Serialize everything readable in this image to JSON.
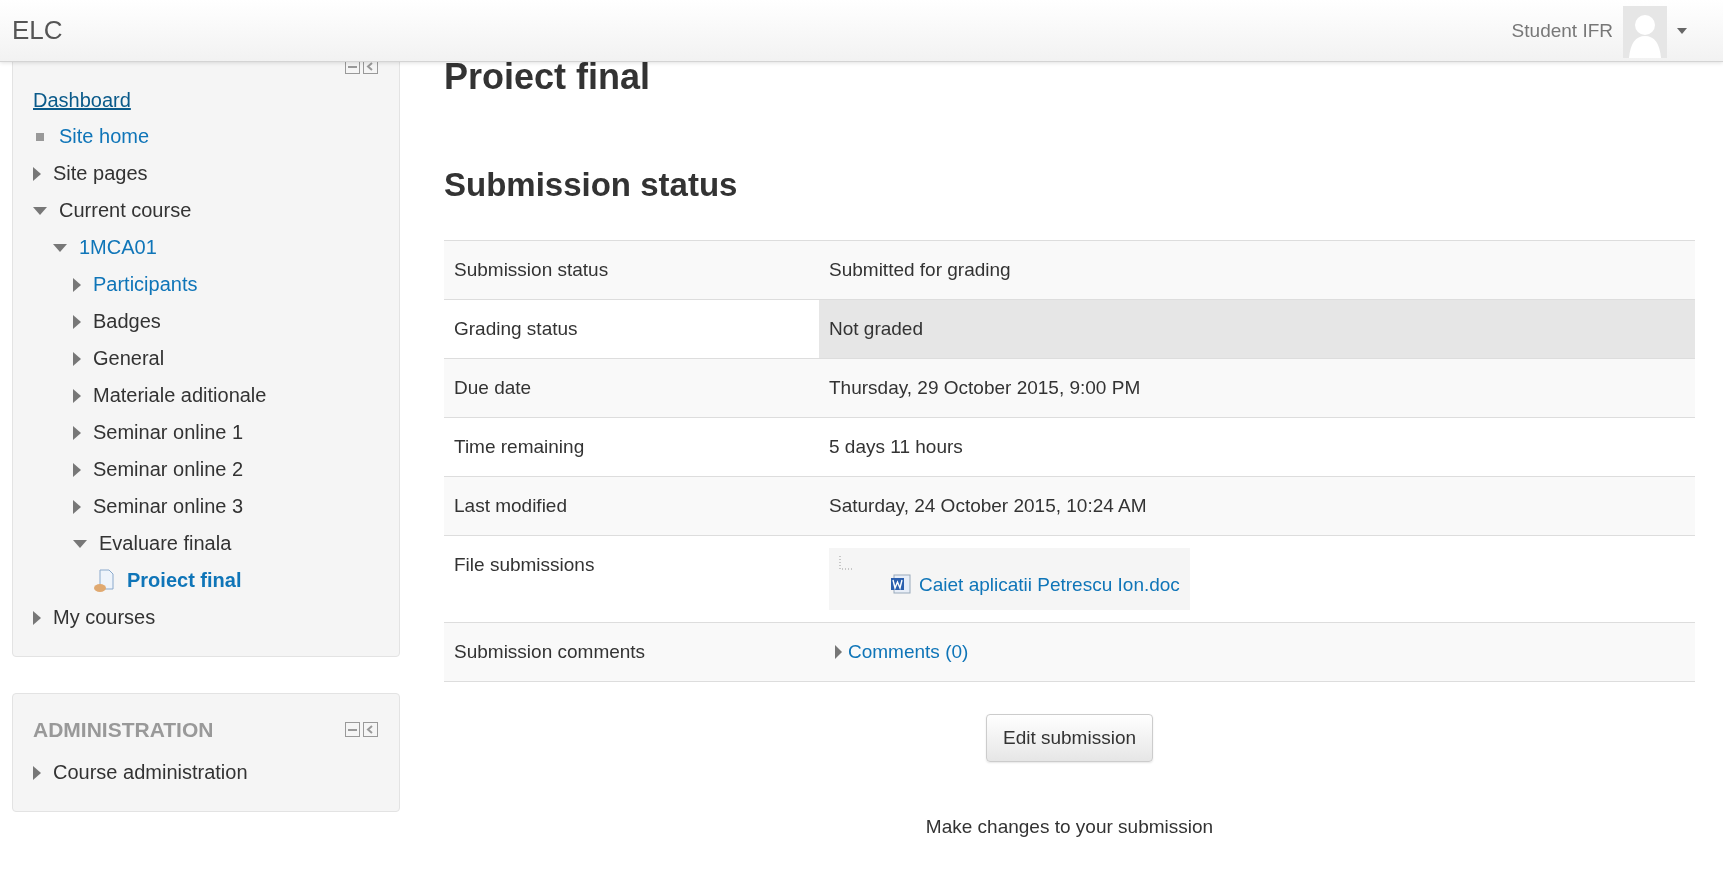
{
  "header": {
    "brand": "ELC",
    "user_name": "Student IFR"
  },
  "navigation": {
    "dashboard": "Dashboard",
    "items": [
      {
        "label": "Site home",
        "kind": "link"
      },
      {
        "label": "Site pages",
        "kind": "text",
        "expanded": false
      },
      {
        "label": "Current course",
        "kind": "text",
        "expanded": true,
        "children": [
          {
            "label": "1MCA01",
            "kind": "link",
            "expanded": true,
            "children": [
              {
                "label": "Participants",
                "kind": "link",
                "expanded": false
              },
              {
                "label": "Badges",
                "kind": "text",
                "expanded": false
              },
              {
                "label": "General",
                "kind": "text",
                "expanded": false
              },
              {
                "label": "Materiale aditionale",
                "kind": "text",
                "expanded": false
              },
              {
                "label": "Seminar online 1",
                "kind": "text",
                "expanded": false
              },
              {
                "label": "Seminar online 2",
                "kind": "text",
                "expanded": false
              },
              {
                "label": "Seminar online 3",
                "kind": "text",
                "expanded": false
              },
              {
                "label": "Evaluare finala",
                "kind": "text",
                "expanded": true,
                "children": [
                  {
                    "label": "Proiect final",
                    "kind": "activity"
                  }
                ]
              }
            ]
          }
        ]
      },
      {
        "label": "My courses",
        "kind": "text",
        "expanded": false
      }
    ]
  },
  "administration": {
    "title": "ADMINISTRATION",
    "items": [
      {
        "label": "Course administration",
        "expanded": false
      }
    ]
  },
  "page_title": "Proiect final",
  "section_title": "Submission status",
  "status_table": [
    {
      "label": "Submission status",
      "value": "Submitted for grading",
      "kind": "text",
      "highlighted": false
    },
    {
      "label": "Grading status",
      "value": "Not graded",
      "kind": "text",
      "highlighted": true
    },
    {
      "label": "Due date",
      "value": "Thursday, 29 October 2015, 9:00 PM",
      "kind": "text",
      "highlighted": false
    },
    {
      "label": "Time remaining",
      "value": "5 days 11 hours",
      "kind": "text",
      "highlighted": false
    },
    {
      "label": "Last modified",
      "value": "Saturday, 24 October 2015, 10:24 AM",
      "kind": "text",
      "highlighted": false
    },
    {
      "label": "File submissions",
      "value": "Caiet aplicatii Petrescu Ion.doc",
      "kind": "file",
      "highlighted": false
    },
    {
      "label": "Submission comments",
      "value": "Comments (0)",
      "kind": "comments",
      "highlighted": false
    }
  ],
  "edit_button": "Edit submission",
  "edit_help": "Make changes to your submission"
}
